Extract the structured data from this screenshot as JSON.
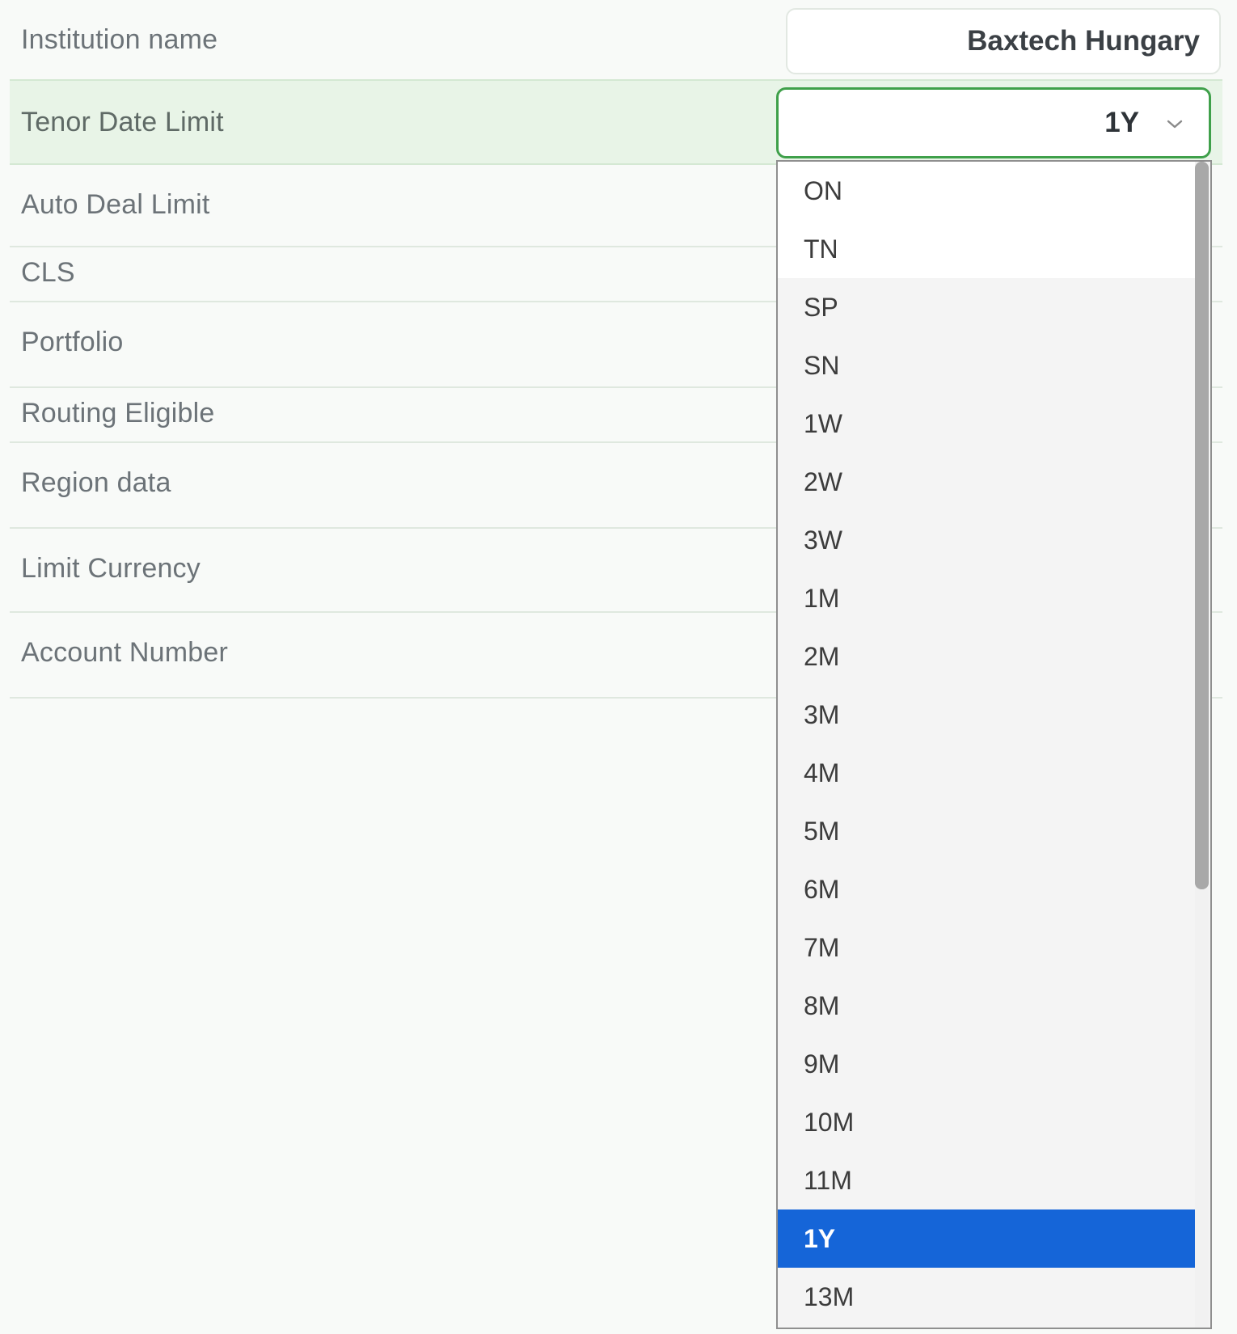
{
  "form": {
    "institution_label": "Institution name",
    "institution_value": "Baxtech Hungary",
    "tenor_label": "Tenor Date Limit",
    "tenor_selected": "1Y",
    "auto_deal_label": "Auto Deal Limit",
    "cls_label": "CLS",
    "portfolio_label": "Portfolio",
    "routing_label": "Routing Eligible",
    "region_label": "Region data",
    "limit_currency_label": "Limit Currency",
    "account_number_label": "Account Number"
  },
  "dropdown": {
    "options": [
      "ON",
      "TN",
      "SP",
      "SN",
      "1W",
      "2W",
      "3W",
      "1M",
      "2M",
      "3M",
      "4M",
      "5M",
      "6M",
      "7M",
      "8M",
      "9M",
      "10M",
      "11M",
      "1Y",
      "13M"
    ],
    "selected": "1Y"
  },
  "colors": {
    "focus_border": "#3fa04a",
    "active_row": "#e8f4e7",
    "selected_option": "#1565d8"
  }
}
